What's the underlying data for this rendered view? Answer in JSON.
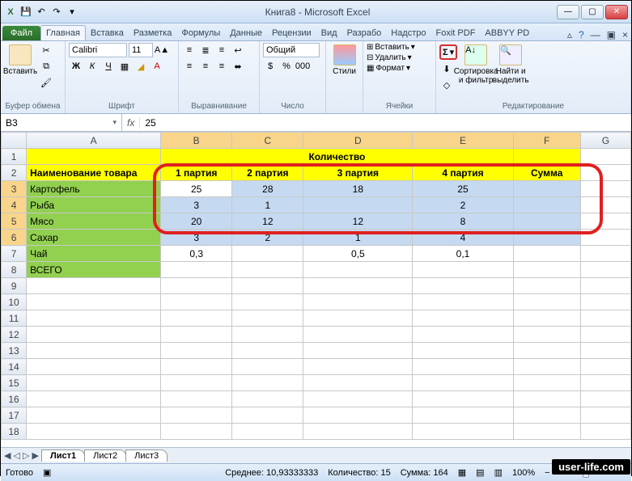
{
  "window": {
    "title": "Книга8 - Microsoft Excel"
  },
  "qat": {
    "save": "💾",
    "undo": "↶",
    "redo": "↷"
  },
  "tabs": {
    "file": "Файл",
    "items": [
      "Главная",
      "Вставка",
      "Разметка",
      "Формулы",
      "Данные",
      "Рецензии",
      "Вид",
      "Разрабо",
      "Надстро",
      "Foxit PDF",
      "ABBYY PD"
    ],
    "active": 0
  },
  "ribbon": {
    "clipboard": {
      "label": "Буфер обмена",
      "paste": "Вставить"
    },
    "font": {
      "label": "Шрифт",
      "name": "Calibri",
      "size": "11"
    },
    "align": {
      "label": "Выравнивание"
    },
    "number": {
      "label": "Число",
      "format": "Общий"
    },
    "styles": {
      "label": "Стили",
      "btn": "Стили"
    },
    "cells": {
      "label": "Ячейки",
      "insert": "Вставить",
      "delete": "Удалить",
      "format": "Формат"
    },
    "editing": {
      "label": "Редактирование",
      "sum": "Σ",
      "sort": "Сортировка и фильтр",
      "find": "Найти и выделить"
    }
  },
  "namebox": "B3",
  "formula": "25",
  "cols": [
    "A",
    "B",
    "C",
    "D",
    "E",
    "F",
    "G"
  ],
  "rows": [
    "1",
    "2",
    "3",
    "4",
    "5",
    "6",
    "7",
    "8",
    "9",
    "10",
    "11",
    "12",
    "13",
    "14",
    "15",
    "16",
    "17",
    "18"
  ],
  "table": {
    "header_qty": "Количество",
    "header_name": "Наименование товара",
    "parties": [
      "1 партия",
      "2 партия",
      "3 партия",
      "4 партия"
    ],
    "sum": "Сумма",
    "rows": [
      {
        "name": "Картофель",
        "v": [
          "25",
          "28",
          "18",
          "25"
        ]
      },
      {
        "name": "Рыба",
        "v": [
          "3",
          "1",
          "",
          "2"
        ]
      },
      {
        "name": "Мясо",
        "v": [
          "20",
          "12",
          "12",
          "8"
        ]
      },
      {
        "name": "Сахар",
        "v": [
          "3",
          "2",
          "1",
          "4"
        ]
      },
      {
        "name": "Чай",
        "v": [
          "0,3",
          "",
          "0,5",
          "0,1"
        ]
      },
      {
        "name": "ВСЕГО",
        "v": [
          "",
          "",
          "",
          ""
        ]
      }
    ]
  },
  "sheets": [
    "Лист1",
    "Лист2",
    "Лист3"
  ],
  "status": {
    "ready": "Готово",
    "avg_label": "Среднее:",
    "avg": "10,93333333",
    "count_label": "Количество:",
    "count": "15",
    "sum_label": "Сумма:",
    "sum": "164",
    "zoom": "100%"
  },
  "watermark": "user-life.com",
  "chart_data": {
    "type": "table",
    "title": "Количество",
    "row_header": "Наименование товара",
    "columns": [
      "1 партия",
      "2 партия",
      "3 партия",
      "4 партия",
      "Сумма"
    ],
    "rows": [
      "Картофель",
      "Рыба",
      "Мясо",
      "Сахар",
      "Чай",
      "ВСЕГО"
    ],
    "values": [
      [
        25,
        28,
        18,
        25,
        null
      ],
      [
        3,
        1,
        null,
        2,
        null
      ],
      [
        20,
        12,
        12,
        8,
        null
      ],
      [
        3,
        2,
        1,
        4,
        null
      ],
      [
        0.3,
        null,
        0.5,
        0.1,
        null
      ],
      [
        null,
        null,
        null,
        null,
        null
      ]
    ],
    "selection": "B3:F6",
    "aggregate": {
      "average": 10.93333333,
      "count": 15,
      "sum": 164
    }
  }
}
